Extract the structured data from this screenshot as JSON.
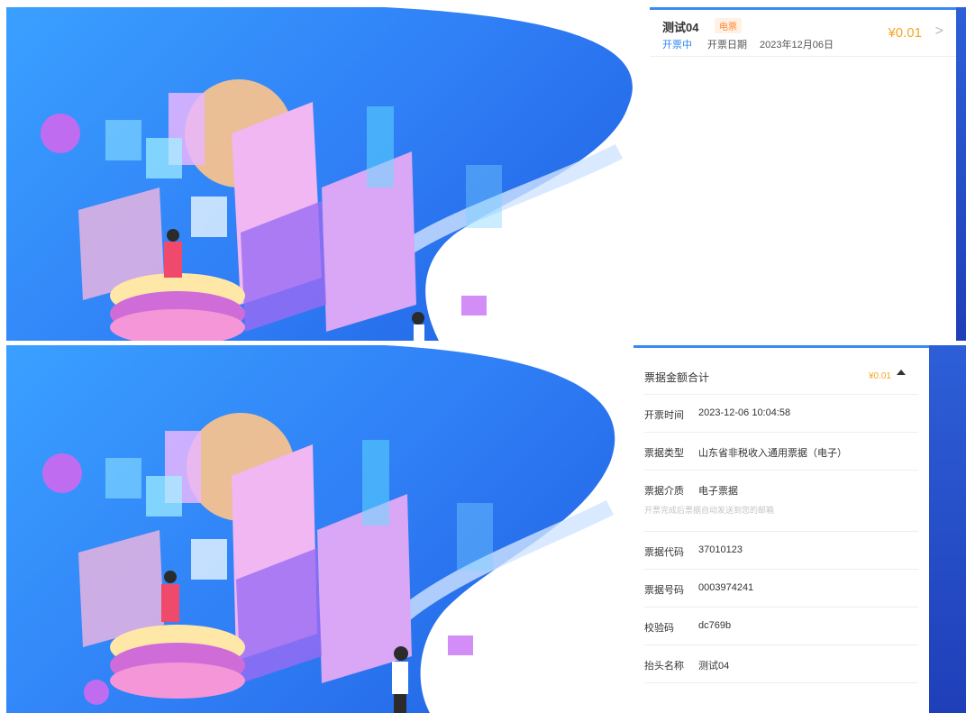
{
  "invoice_list": {
    "items": [
      {
        "title": "测试04",
        "tag": "电票",
        "status": "开票中",
        "date_label": "开票日期",
        "date": "2023年12月06日",
        "amount": "¥0.01",
        "chevron": ">"
      }
    ]
  },
  "invoice_detail": {
    "total_label": "票据金额合计",
    "total_amount": "¥0.01",
    "rows": [
      {
        "label": "开票时间",
        "value": "2023-12-06 10:04:58"
      },
      {
        "label": "票据类型",
        "value": "山东省非税收入通用票据（电子）"
      },
      {
        "label": "票据介质",
        "value": "电子票据",
        "note": "开票完成后票据自动发送到您的邮箱"
      },
      {
        "label": "票据代码",
        "value": "37010123"
      },
      {
        "label": "票据号码",
        "value": "0003974241"
      },
      {
        "label": "校验码",
        "value": "dc769b"
      },
      {
        "label": "抬头名称",
        "value": "测试04"
      }
    ]
  },
  "colors": {
    "accent": "#2f86f3",
    "amount": "#f5a623",
    "tag": "#ff8a3d",
    "background_blue": "#2f7df5"
  }
}
